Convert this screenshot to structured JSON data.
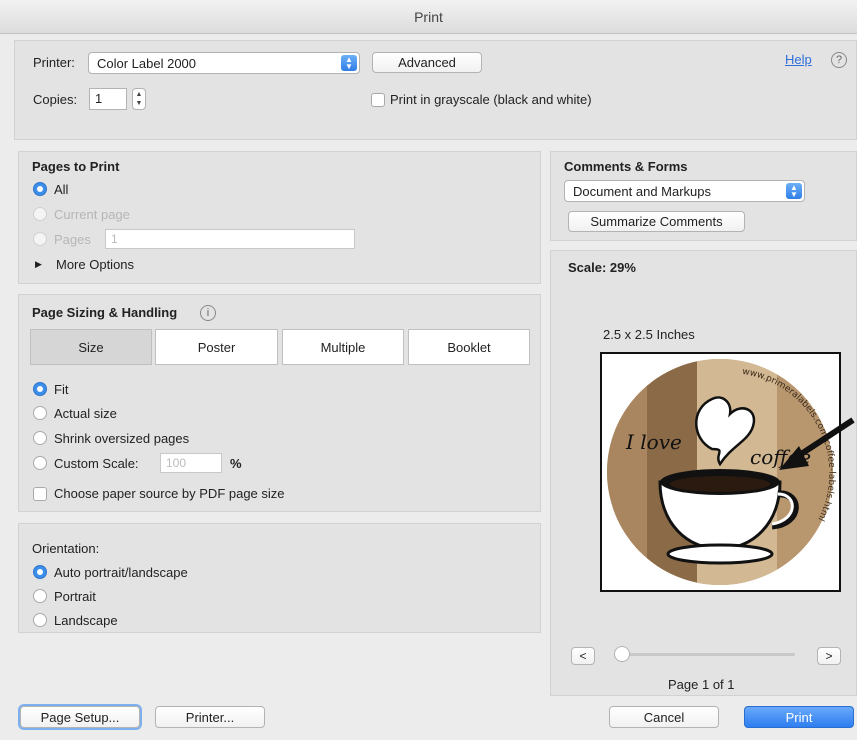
{
  "window": {
    "title": "Print"
  },
  "top": {
    "printer_label": "Printer:",
    "printer_value": "Color Label 2000",
    "advanced_label": "Advanced",
    "help_label": "Help",
    "help_icon_glyph": "?",
    "copies_label": "Copies:",
    "copies_value": "1",
    "grayscale_label": "Print in grayscale (black and white)",
    "grayscale_checked": false
  },
  "pages_to_print": {
    "title": "Pages to Print",
    "options": [
      {
        "label": "All",
        "selected": true,
        "enabled": true
      },
      {
        "label": "Current page",
        "selected": false,
        "enabled": false
      },
      {
        "label": "Pages",
        "selected": false,
        "enabled": false
      }
    ],
    "pages_field_value": "1",
    "more_options_label": "More Options",
    "more_options_glyph": "▶"
  },
  "page_sizing": {
    "title": "Page Sizing & Handling",
    "info_glyph": "i",
    "tabs": [
      "Size",
      "Poster",
      "Multiple",
      "Booklet"
    ],
    "active_tab": "Size",
    "options": [
      {
        "label": "Fit",
        "selected": true
      },
      {
        "label": "Actual size",
        "selected": false
      },
      {
        "label": "Shrink oversized pages",
        "selected": false
      },
      {
        "label": "Custom Scale:",
        "selected": false
      }
    ],
    "custom_scale_value": "100",
    "percent_sign": "%",
    "paper_source_label": "Choose paper source by PDF page size"
  },
  "orientation": {
    "title": "Orientation:",
    "options": [
      {
        "label": "Auto portrait/landscape",
        "selected": true
      },
      {
        "label": "Portrait",
        "selected": false
      },
      {
        "label": "Landscape",
        "selected": false
      }
    ]
  },
  "comments_forms": {
    "title": "Comments & Forms",
    "value": "Document and Markups",
    "summarize_label": "Summarize Comments"
  },
  "preview": {
    "scale_label": "Scale:  29%",
    "size_label": "2.5 x 2.5 Inches",
    "label_text_love": "I love",
    "label_text_coffee": "coffee",
    "label_url": "www.primeralabels.com/coffee-labels.html",
    "prev_glyph": "<",
    "next_glyph": ">",
    "page_indicator": "Page 1 of 1",
    "slider_fraction": 0
  },
  "bottom": {
    "page_setup_label": "Page Setup...",
    "printer_label": "Printer...",
    "cancel_label": "Cancel",
    "print_label": "Print"
  },
  "colors": {
    "accent": "#3b8eea",
    "label_tan": "#b8976f",
    "label_dark": "#8b6a47",
    "label_light": "#d9c3a2"
  }
}
